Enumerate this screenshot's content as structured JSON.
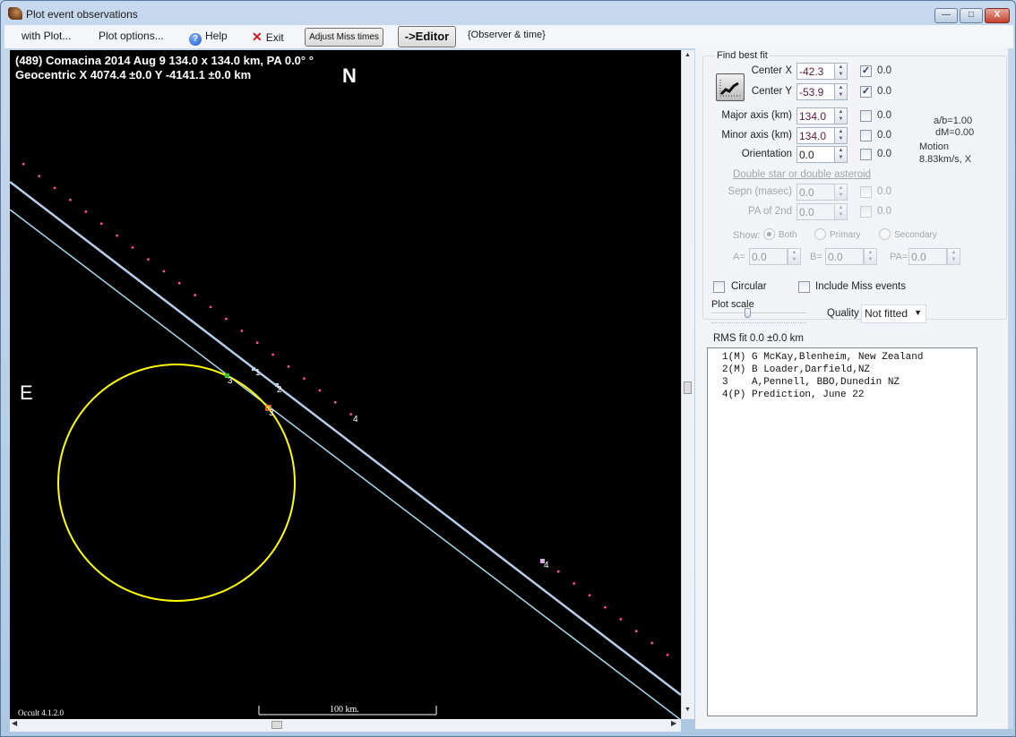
{
  "window": {
    "title": "Plot event observations",
    "controls": {
      "minimize": "—",
      "maximize": "□",
      "close": "X"
    }
  },
  "menu": {
    "with_plot": "with Plot...",
    "plot_options": "Plot options...",
    "help": "Help",
    "help_icon": "?",
    "exit": "Exit",
    "exit_icon": "✕",
    "adjust_miss_times": "Adjust Miss times",
    "editor": "->Editor",
    "observer_time": "{Observer & time}"
  },
  "plot": {
    "title_line1": "(489) Comacina  2014 Aug 9   134.0 x 134.0 km, PA 0.0° °",
    "title_line2": "Geocentric  X  4074.4 ±0.0  Y -4141.1 ±0.0 km",
    "north_label": "N",
    "east_label": "E",
    "version": "Occult 4.1.2.0",
    "scale_label": "100 km.",
    "colors": {
      "background": "#000000",
      "ellipse": "#ffff00",
      "chord": "#b0c8e8",
      "chord_secondary": "#a8d8e8",
      "prediction_dots": "#ff4fa0",
      "event_green": "#22cc22",
      "event_orange": "#ff7a30"
    },
    "event_labels": [
      {
        "id": "1",
        "color": "#ffffff"
      },
      {
        "id": "2",
        "color": "#ffffff"
      },
      {
        "id": "3",
        "color": "#ffffff"
      },
      {
        "id": "3",
        "color": "#ffffff"
      },
      {
        "id": "4",
        "color": "#ffffff"
      },
      {
        "id": "4",
        "color": "#ffffff"
      }
    ]
  },
  "fit_panel": {
    "group_title": "Find best fit",
    "fields": [
      {
        "label": "Center X",
        "value": "-42.3",
        "checked": true,
        "uncertainty": "0.0"
      },
      {
        "label": "Center Y",
        "value": "-53.9",
        "checked": true,
        "uncertainty": "0.0"
      },
      {
        "label": "Major axis (km)",
        "value": "134.0",
        "checked": false,
        "uncertainty": "0.0"
      },
      {
        "label": "Minor axis (km)",
        "value": "134.0",
        "checked": false,
        "uncertainty": "0.0"
      },
      {
        "label": "Orientation",
        "value": "0.0",
        "checked": false,
        "uncertainty": "0.0"
      }
    ],
    "ratio_info": "a/b=1.00",
    "dm_info": "dM=0.00",
    "motion_label": "Motion",
    "motion_value": "8.83km/s, X",
    "double_star_link": "Double star  or  double asteroid",
    "double_fields": [
      {
        "label": "Sepn (masec)",
        "value": "0.0",
        "uncertainty": "0.0"
      },
      {
        "label": "PA of 2nd",
        "value": "0.0",
        "uncertainty": "0.0"
      }
    ],
    "show_label": "Show:",
    "show_options": [
      "Both",
      "Primary",
      "Secondary"
    ],
    "show_selected": "Both",
    "ab_fields": [
      {
        "label": "A=",
        "value": "0.0"
      },
      {
        "label": "B=",
        "value": "0.0"
      },
      {
        "label": "PA=",
        "value": "0.0"
      }
    ]
  },
  "options": {
    "circular_label": "Circular",
    "circular_checked": false,
    "include_miss_label": "Include Miss events",
    "include_miss_checked": false,
    "plot_scale_label": "Plot scale",
    "quality_label": "Quality",
    "quality_value": "Not fitted",
    "rms_fit": "RMS fit 0.0 ±0.0 km"
  },
  "observers": [
    "1(M) G McKay,Blenheim, New Zealand",
    "2(M) B Loader,Darfield,NZ",
    "3    A,Pennell, BBO,Dunedin NZ",
    "4(P) Prediction, June 22"
  ]
}
